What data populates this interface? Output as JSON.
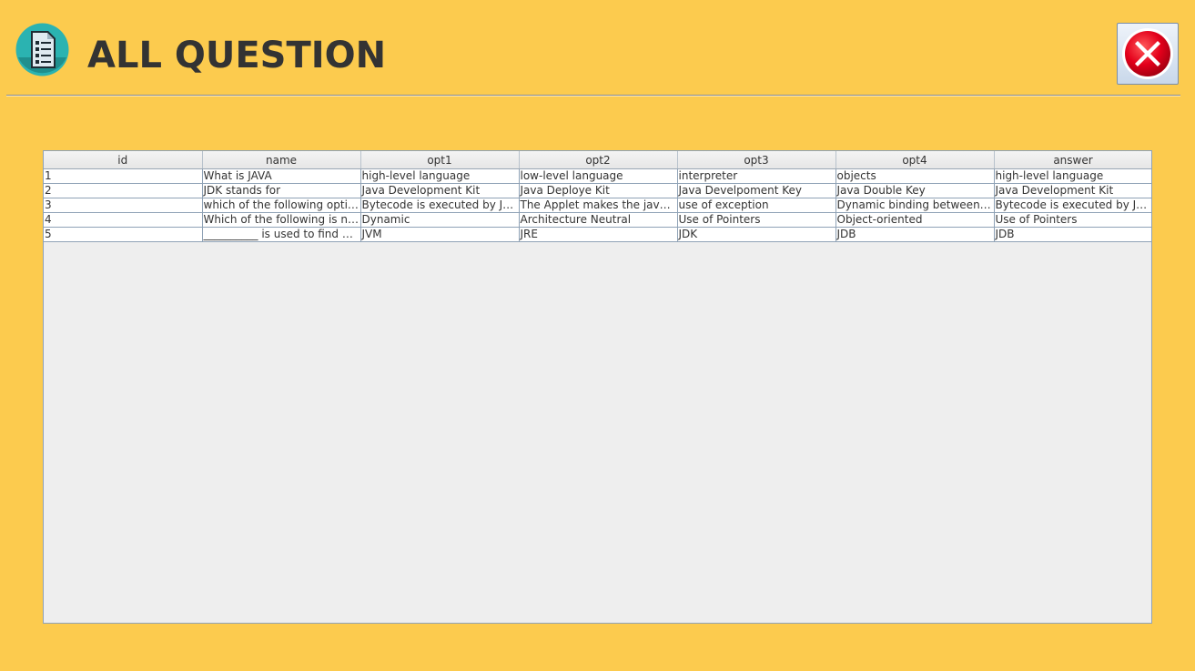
{
  "header": {
    "title": "ALL QUESTION",
    "icon": "document-checklist-icon",
    "icon_color": "#2bb3b1"
  },
  "close_button": {
    "icon": "close-x-icon",
    "color": "#e3001b"
  },
  "table": {
    "columns": [
      "id",
      "name",
      "opt1",
      "opt2",
      "opt3",
      "opt4",
      "answer"
    ],
    "rows": [
      {
        "id": "1",
        "name": "What is JAVA",
        "opt1": "high-level language",
        "opt2": "low-level language",
        "opt3": "interpreter",
        "opt4": "objects",
        "answer": "high-level language"
      },
      {
        "id": "2",
        "name": "JDK stands for",
        "opt1": "Java Development Kit",
        "opt2": "Java Deploye Kit",
        "opt3": "Java Develpoment Key",
        "opt4": "Java Double Key",
        "answer": "Java Development Kit"
      },
      {
        "id": "3",
        "name": "which of the following options...",
        "opt1": "Bytecode is executed by JVM",
        "opt2": "The Applet makes the java co...",
        "opt3": "use of exception",
        "opt4": "Dynamic binding between obj...",
        "answer": "Bytecode is executed by JVM"
      },
      {
        "id": "4",
        "name": "Which of the following is not a...",
        "opt1": "Dynamic",
        "opt2": "Architecture Neutral",
        "opt3": "Use of Pointers",
        "opt4": "Object-oriented",
        "answer": "Use of Pointers"
      },
      {
        "id": "5",
        "name": "__________ is used to find a...",
        "opt1": "JVM",
        "opt2": "JRE",
        "opt3": "JDK",
        "opt4": "JDB",
        "answer": "JDB"
      }
    ]
  },
  "colors": {
    "background": "#fccb4e",
    "title_text": "#333333",
    "table_panel": "#eeeeee"
  }
}
